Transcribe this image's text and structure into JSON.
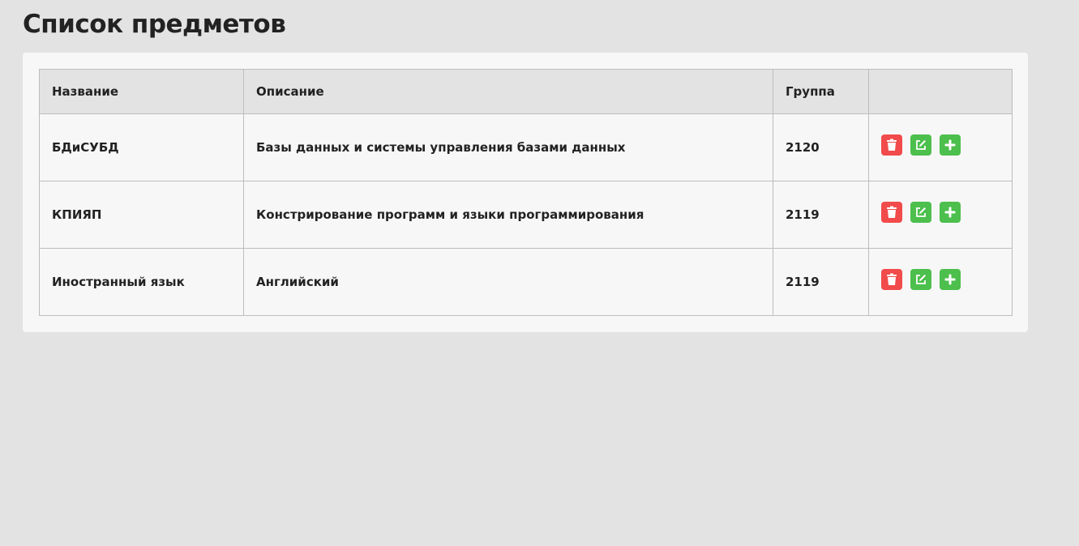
{
  "page": {
    "title": "Список предметов"
  },
  "table": {
    "headers": {
      "name": "Название",
      "description": "Описание",
      "group": "Группа",
      "actions": ""
    },
    "rows": [
      {
        "name": "БДиСУБД",
        "description": "Базы данных и системы управления базами данных",
        "group": "2120"
      },
      {
        "name": "КПИЯП",
        "description": "Констрирование программ и языки программирования",
        "group": "2119"
      },
      {
        "name": "Иностранный язык",
        "description": "Английский",
        "group": "2119"
      }
    ]
  },
  "actions": {
    "delete_icon": "trash-icon",
    "edit_icon": "edit-icon",
    "add_icon": "plus-icon"
  },
  "colors": {
    "background": "#e3e3e3",
    "panel": "#f7f7f7",
    "delete": "#f24b4b",
    "edit": "#4cbf4c",
    "add": "#4cbf4c"
  }
}
